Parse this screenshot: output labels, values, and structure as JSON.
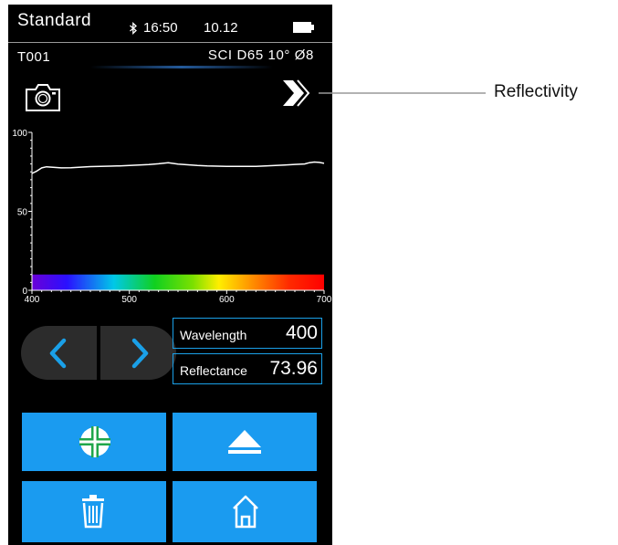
{
  "status_bar": {
    "title": "Standard",
    "bluetooth_icon": "bluetooth-icon",
    "time": "16:50",
    "date": "10.12",
    "battery_icon": "battery-icon"
  },
  "info_bar": {
    "sample_id": "T001",
    "conditions": "SCI D65 10° Ø8"
  },
  "toolbar": {
    "camera_icon": "camera-icon",
    "reflectivity_icon": "double-chevron-right-icon"
  },
  "chart_data": {
    "type": "line",
    "title": "",
    "xlabel": "",
    "ylabel": "",
    "xlim": [
      400,
      700
    ],
    "ylim": [
      0,
      100
    ],
    "x_ticks": [
      "400",
      "500",
      "600",
      "700"
    ],
    "y_ticks": [
      "0",
      "50",
      "100"
    ],
    "grid": false,
    "spectrum_band": true,
    "series": [
      {
        "x": [
          400,
          405,
          410,
          415,
          420,
          430,
          440,
          450,
          460,
          470,
          480,
          490,
          500,
          510,
          520,
          530,
          540,
          550,
          560,
          570,
          580,
          590,
          600,
          610,
          620,
          630,
          640,
          650,
          660,
          670,
          680,
          685,
          690,
          695,
          700
        ],
        "y": [
          73.96,
          75.5,
          77.5,
          78.2,
          78.0,
          77.5,
          77.6,
          78.0,
          78.3,
          78.5,
          78.6,
          78.8,
          79.0,
          79.3,
          79.6,
          80.1,
          80.8,
          79.9,
          79.5,
          79.0,
          78.7,
          78.6,
          78.5,
          78.5,
          78.5,
          78.5,
          78.7,
          79.0,
          79.3,
          79.7,
          80.0,
          80.8,
          81.2,
          81.0,
          80.4
        ]
      }
    ]
  },
  "navigation": {
    "prev_icon": "chevron-left-icon",
    "next_icon": "chevron-right-icon"
  },
  "readout": {
    "wavelength_label": "Wavelength",
    "wavelength_value": "400",
    "reflectance_label": "Reflectance",
    "reflectance_value": "73.96"
  },
  "actions": {
    "standard_icon": "crosshair-target-icon",
    "eject_icon": "eject-icon",
    "delete_icon": "trash-icon",
    "home_icon": "home-icon"
  },
  "annotation": {
    "reflectivity_label": "Reflectivity"
  },
  "colors": {
    "accent_blue": "#1a9bf0",
    "tile_icon_green": "#1fa64a",
    "screen_background": "#000000"
  }
}
